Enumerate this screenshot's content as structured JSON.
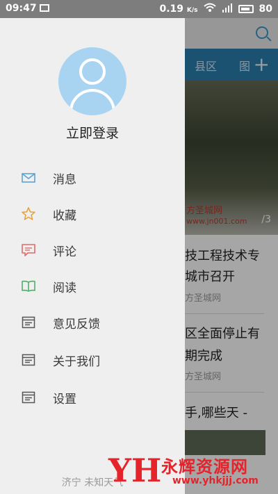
{
  "status_bar": {
    "time": "09:47",
    "speed": "0.19",
    "speed_unit": "K/s",
    "battery": "80"
  },
  "background": {
    "tabs": [
      "县区",
      "图"
    ],
    "photo_caption": "方圣城网",
    "photo_url_text": "www.jn001.com",
    "photo_counter": "/3",
    "news": [
      {
        "line1": "技工程技术专",
        "line2": "城市召开",
        "source": "方圣城网"
      },
      {
        "line1": "区全面停止有",
        "line2": "期完成",
        "source": "方圣城网"
      },
      {
        "line1": "手,哪些天 -",
        "line2": "",
        "source": ""
      }
    ]
  },
  "drawer": {
    "login_label": "立即登录",
    "items": [
      {
        "icon": "envelope-icon",
        "label": "消息",
        "color": "#5aa2d6"
      },
      {
        "icon": "star-icon",
        "label": "收藏",
        "color": "#e8a23c"
      },
      {
        "icon": "comment-icon",
        "label": "评论",
        "color": "#e06a6a"
      },
      {
        "icon": "book-icon",
        "label": "阅读",
        "color": "#4fae6a"
      },
      {
        "icon": "feedback-icon",
        "label": "意见反馈",
        "color": "#555555"
      },
      {
        "icon": "about-icon",
        "label": "关于我们",
        "color": "#555555"
      },
      {
        "icon": "settings-icon",
        "label": "设置",
        "color": "#555555"
      }
    ],
    "footer": "济宁  未知天气"
  },
  "watermark": {
    "logo": "YH",
    "title": "永辉资源网",
    "url": "www.yhkjjj.com"
  }
}
